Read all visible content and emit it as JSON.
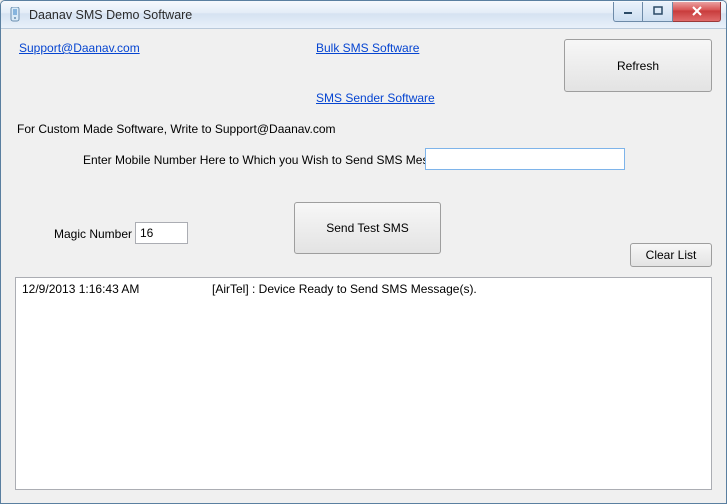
{
  "window": {
    "title": "Daanav SMS Demo Software"
  },
  "links": {
    "support": "Support@Daanav.com",
    "bulk_sms": "Bulk SMS Software",
    "sms_sender": "SMS Sender Software"
  },
  "buttons": {
    "refresh": "Refresh",
    "send_test": "Send Test SMS",
    "clear_list": "Clear List"
  },
  "labels": {
    "custom_note": "For Custom Made Software, Write to Support@Daanav.com",
    "mobile_prompt": "Enter Mobile Number Here to Which you Wish to Send SMS Message :",
    "magic_number": "Magic Number :"
  },
  "inputs": {
    "mobile_value": "",
    "magic_value": "16"
  },
  "log": {
    "rows": [
      {
        "ts": "12/9/2013 1:16:43 AM",
        "msg": "[AirTel] : Device Ready to Send SMS Message(s)."
      }
    ]
  }
}
